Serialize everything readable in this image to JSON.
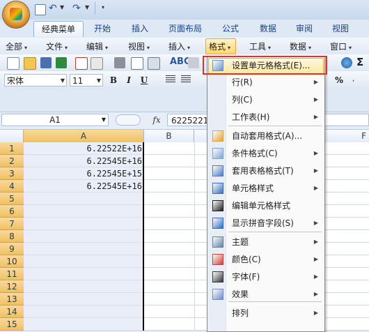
{
  "ribbon_tabs": [
    "经典菜单",
    "开始",
    "插入",
    "页面布局",
    "公式",
    "数据",
    "审阅",
    "视图"
  ],
  "menu_bar": [
    "全部",
    "文件",
    "编辑",
    "视图",
    "插入",
    "格式",
    "工具",
    "数据",
    "窗口"
  ],
  "toolbar": {
    "font_name": "宋体",
    "font_size": "11",
    "bold": "B",
    "italic": "I",
    "underline": "U",
    "percent": "%",
    "sigma": "Σ"
  },
  "formula_bar": {
    "name_box": "A1",
    "fx_label": "fx",
    "value": "6225221"
  },
  "columns": [
    "A",
    "B",
    "F"
  ],
  "rows": [
    "1",
    "2",
    "3",
    "4",
    "5",
    "6",
    "7",
    "8",
    "9",
    "10",
    "11",
    "12",
    "13",
    "14",
    "15"
  ],
  "cells_A": [
    "6.22522E+16",
    "6.22545E+16",
    "6.22545E+15",
    "6.22545E+16"
  ],
  "format_menu": {
    "items": [
      {
        "label": "设置单元格格式(E)...",
        "icon": "format-cells-icon"
      },
      {
        "label": "行(R)",
        "submenu": true
      },
      {
        "label": "列(C)",
        "submenu": true
      },
      {
        "label": "工作表(H)",
        "submenu": true
      },
      {
        "label": "自动套用格式(A)...",
        "icon": "autoformat-icon"
      },
      {
        "label": "条件格式(C)",
        "icon": "conditional-format-icon",
        "submenu": true
      },
      {
        "label": "套用表格格式(T)",
        "icon": "table-style-icon",
        "submenu": true
      },
      {
        "label": "单元格样式",
        "icon": "cell-style-icon",
        "submenu": true
      },
      {
        "label": "编辑单元格样式",
        "icon": "edit-cell-style-icon"
      },
      {
        "label": "显示拼音字段(S)",
        "icon": "pinyin-icon",
        "submenu": true
      },
      {
        "label": "主题",
        "icon": "theme-icon",
        "submenu": true
      },
      {
        "label": "颜色(C)",
        "icon": "color-icon",
        "submenu": true
      },
      {
        "label": "字体(F)",
        "icon": "font-icon",
        "submenu": true
      },
      {
        "label": "效果",
        "icon": "effects-icon",
        "submenu": true
      },
      {
        "label": "排列",
        "submenu": true
      }
    ]
  },
  "colors": {
    "highlight_border": "#e0302a",
    "hover": "#ffe7a3",
    "row_header_selected": "#f1c15f"
  }
}
